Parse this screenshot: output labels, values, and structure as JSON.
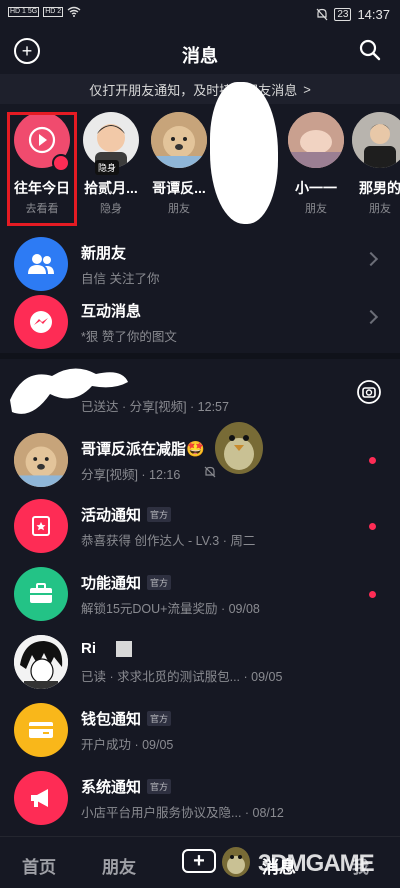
{
  "status": {
    "signal_left": "HD 1 5G",
    "signal_left2": "HD 2",
    "battery": "23",
    "time": "14:37"
  },
  "header": {
    "title": "消息"
  },
  "banner": {
    "text": "仅打开朋友通知，及时接收朋友消息",
    "arrow": ">"
  },
  "stories": [
    {
      "name": "往年今日",
      "sub": "去看看"
    },
    {
      "name": "拾贰月...",
      "sub": "隐身",
      "badge": "隐身"
    },
    {
      "name": "哥谭反...",
      "sub": "朋友"
    },
    {
      "name": "小一一",
      "sub": "朋友"
    },
    {
      "name": "那男的",
      "sub": "朋友"
    }
  ],
  "rows": [
    {
      "title": "新朋友",
      "sub": "自信 关注了你",
      "icon": "people-icon",
      "color": "#2d7bf4"
    },
    {
      "title": "互动消息",
      "sub": "*狠 赞了你的图文",
      "icon": "messenger-icon",
      "color": "#fe2c55"
    },
    {
      "title": "",
      "sub": "已送达 · 分享[视频] · 12:57",
      "icon": "camera-icon"
    },
    {
      "title": "哥谭反派在减脂🤩",
      "sub": "分享[视频] · 12:16"
    },
    {
      "title": "活动通知",
      "tag": "官方",
      "sub": "恭喜获得  创作达人 - LV.3 · 周二",
      "color": "#fe2c55"
    },
    {
      "title": "功能通知",
      "tag": "官方",
      "sub": "解锁15元DOU+流量奖励 · 09/08",
      "color": "#23c386"
    },
    {
      "title": "Ri",
      "sub": "已读 · 求求北觅的测试服包... · 09/05"
    },
    {
      "title": "钱包通知",
      "tag": "官方",
      "sub": "开户成功 · 09/05",
      "color": "#f9b71a"
    },
    {
      "title": "系统通知",
      "tag": "官方",
      "sub": "小店平台用户服务协议及隐... · 08/12",
      "color": "#fe2c55"
    }
  ],
  "nav": {
    "home": "首页",
    "friends": "朋友",
    "messages": "消息",
    "me": "我"
  },
  "watermark": "3DMGAME"
}
